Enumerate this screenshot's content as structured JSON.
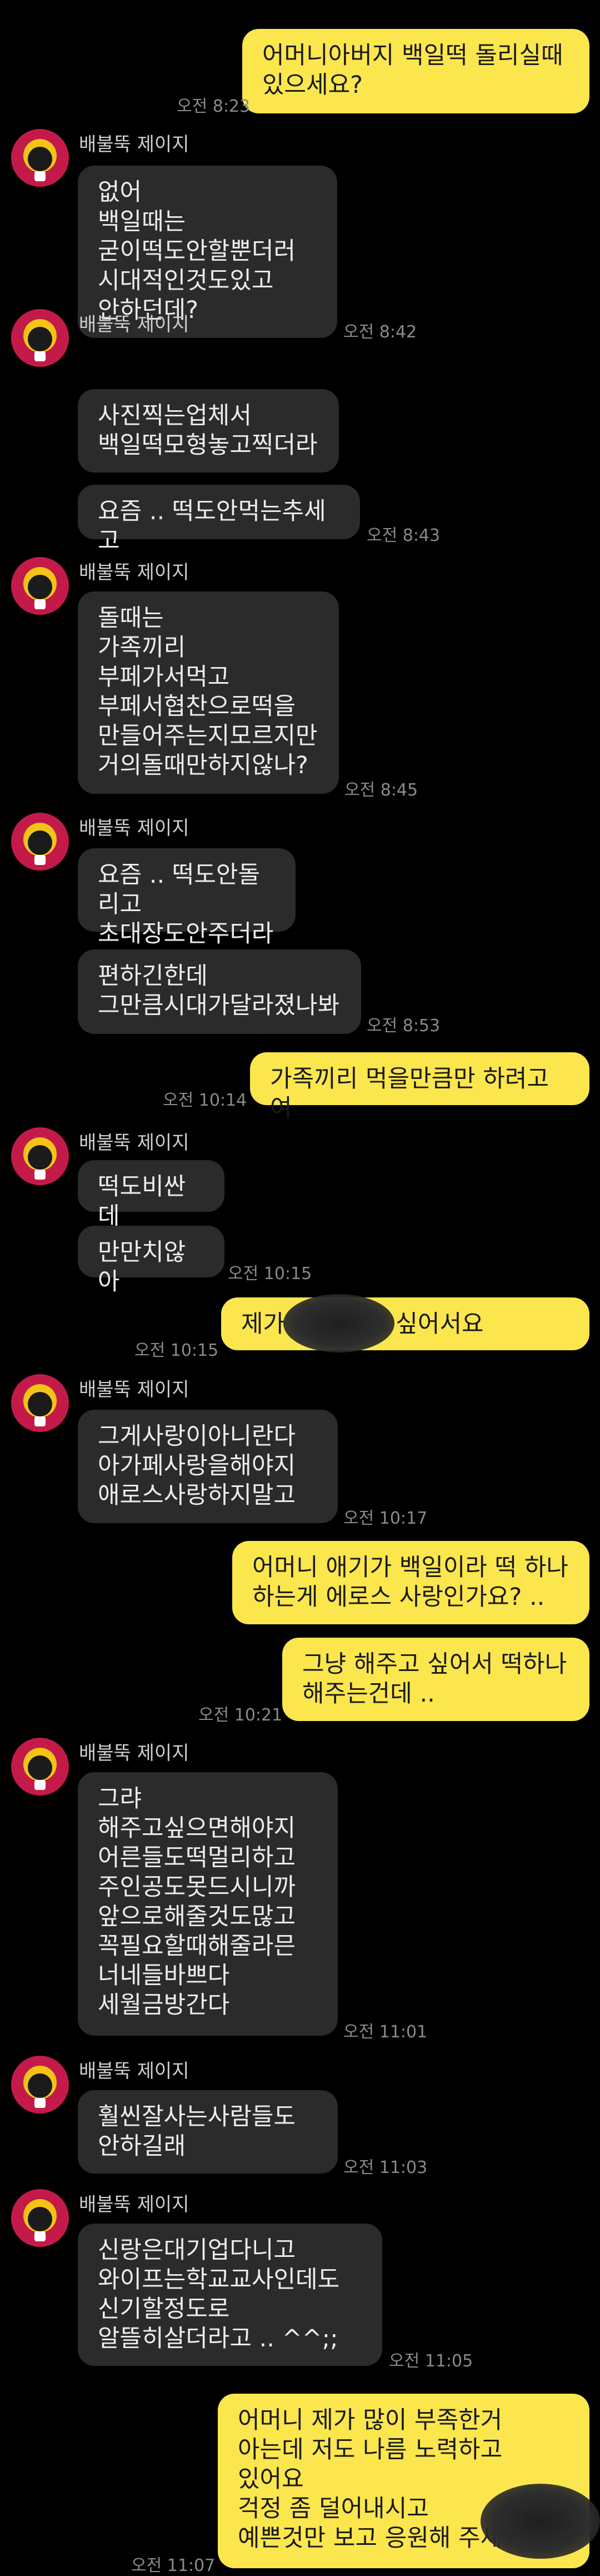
{
  "contact": {
    "name": "배불뚝 제이지"
  },
  "messages": [
    {
      "id": "m1",
      "sender": "me",
      "text": "어머니아버지 백일떡 돌리실때\n있으세요?",
      "time": "오전 8:23"
    },
    {
      "id": "m2",
      "sender": "them",
      "text": "없어\n백일때는\n굳이떡도안할뿐더러\n시대적인것도있고\n안하던데?",
      "time": "오전 8:42"
    },
    {
      "id": "m3",
      "sender": "them",
      "text": "사진찍는업체서\n백일떡모형놓고찍더라",
      "time": ""
    },
    {
      "id": "m4",
      "sender": "them",
      "text": "요즘 .. 떡도안먹는추세고",
      "time": "오전 8:43"
    },
    {
      "id": "m5",
      "sender": "them",
      "text": "돌때는\n가족끼리\n부페가서먹고\n부페서협찬으로떡을\n만들어주는지모르지만\n거의돌때만하지않나?",
      "time": "오전 8:45"
    },
    {
      "id": "m6",
      "sender": "them",
      "text": "요즘 .. 떡도안돌리고\n초대장도안주더라",
      "time": ""
    },
    {
      "id": "m7",
      "sender": "them",
      "text": "편하긴한데\n그만큼시대가달라졌나봐",
      "time": "오전 8:53"
    },
    {
      "id": "m8",
      "sender": "me",
      "text": "가족끼리 먹을만큼만 하려고여",
      "time": "오전 10:14"
    },
    {
      "id": "m9",
      "sender": "them",
      "text": "떡도비싼데",
      "time": ""
    },
    {
      "id": "m10",
      "sender": "them",
      "text": "만만치않아",
      "time": "오전 10:15"
    },
    {
      "id": "m11",
      "sender": "me",
      "text": "제가              테 해주고 싶어서요",
      "time": "오전 10:15"
    },
    {
      "id": "m12",
      "sender": "them",
      "text": "그게사랑이아니란다\n아가페사랑을해야지\n애로스사랑하지말고",
      "time": "오전 10:17"
    },
    {
      "id": "m13",
      "sender": "me",
      "text": "어머니 애기가 백일이라 떡 하나\n하는게 에로스 사랑인가요? ..",
      "time": ""
    },
    {
      "id": "m14",
      "sender": "me",
      "text": "그냥 해주고 싶어서 떡하나\n해주는건데 ..",
      "time": "오전 10:21"
    },
    {
      "id": "m15",
      "sender": "them",
      "text": "그랴\n해주고싶으면해야지\n어른들도떡멀리하고\n주인공도못드시니까\n앞으로해줄것도많고\n꼭필요할때해줄라믄\n너네들바쁘다\n세월금방간다",
      "time": "오전 11:01"
    },
    {
      "id": "m16",
      "sender": "them",
      "text": "훨씬잘사는사람들도\n안하길래",
      "time": "오전 11:03"
    },
    {
      "id": "m17",
      "sender": "them",
      "text": "신랑은대기업다니고\n와이프는학교교사인데도\n신기할정도로\n알뜰히살더라고 .. ^^;;",
      "time": "오전 11:05"
    },
    {
      "id": "m18",
      "sender": "me",
      "text": "어머니 제가 많이 부족한거\n아는데 저도 나름 노력하고\n있어요\n걱정 좀 덜어내시고\n예쁜것만 보고 응원해 주세요 😊",
      "time": "오전 11:07"
    }
  ]
}
